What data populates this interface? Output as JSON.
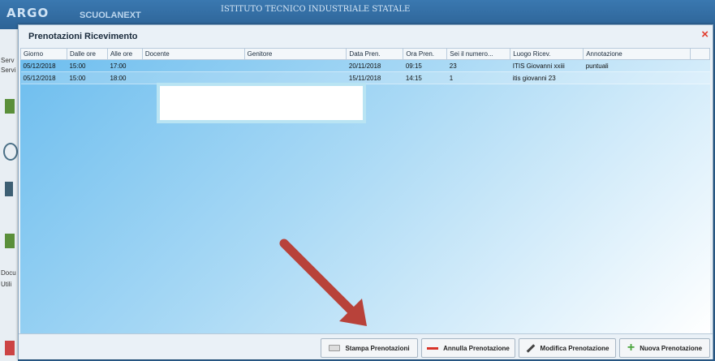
{
  "background": {
    "logo": "ARGO",
    "logo_sub": "SCUOLANEXT",
    "school": "ISTITUTO TECNICO INDUSTRIALE STATALE",
    "left_texts": [
      "Serv",
      "Servi",
      "Docu",
      "Utili"
    ]
  },
  "dialog": {
    "title": "Prenotazioni Ricevimento",
    "close": "×",
    "columns": [
      "Giorno",
      "Dalle ore",
      "Alle ore",
      "Docente",
      "Genitore",
      "Data Pren.",
      "Ora Pren.",
      "Sei il numero...",
      "Luogo Ricev.",
      "Annotazione"
    ],
    "rows": [
      [
        "05/12/2018",
        "15:00",
        "17:00",
        "",
        "",
        "20/11/2018",
        "09:15",
        "23",
        "ITIS Giovanni xxiii",
        "puntuali"
      ],
      [
        "05/12/2018",
        "15:00",
        "18:00",
        "",
        "",
        "15/11/2018",
        "14:15",
        "1",
        "itis giovanni 23",
        ""
      ]
    ],
    "buttons": {
      "stampa": "Stampa Prenotazioni",
      "annulla": "Annulla Prenotazione",
      "modifica": "Modifica Prenotazione",
      "nuova": "Nuova Prenotazione"
    }
  },
  "colors": {
    "close": "#e23b2c",
    "annotation_arrow": "#b8423a",
    "add_icon": "#49a43c",
    "remove_icon": "#d8342a"
  }
}
